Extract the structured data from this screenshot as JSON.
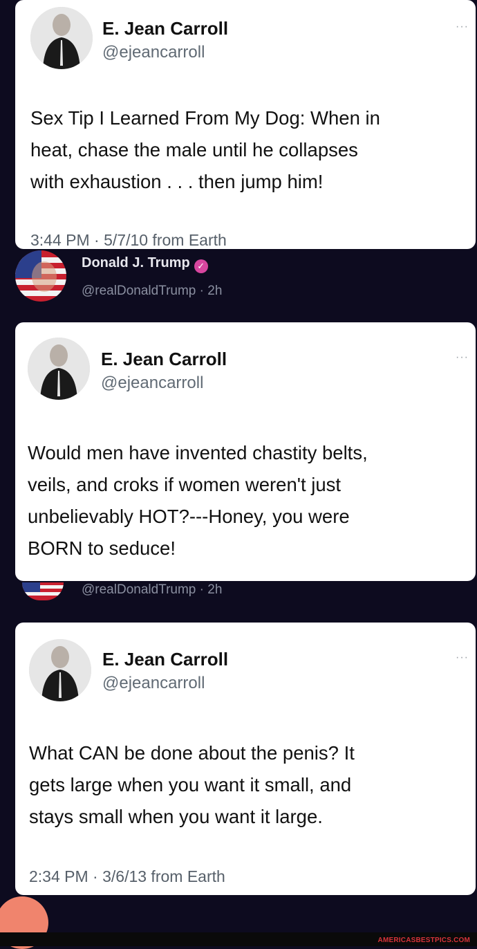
{
  "tweets": [
    {
      "name": "E. Jean Carroll",
      "handle": "@ejeancarroll",
      "more": "···",
      "text_lines": [
        "Sex Tip I Learned From My Dog:  When in",
        "heat, chase the male until he collapses",
        "with exhaustion  . . . then jump him!"
      ],
      "meta": "3:44 PM · 5/7/10 from Earth"
    },
    {
      "name": "E. Jean Carroll",
      "handle": "@ejeancarroll",
      "more": "···",
      "text_lines": [
        "Would men have invented chastity belts,",
        "veils, and croks if women weren't just",
        "unbelievably HOT?---Honey, you were",
        "BORN to seduce!"
      ]
    },
    {
      "name": "E. Jean Carroll",
      "handle": "@ejeancarroll",
      "more": "···",
      "text_lines": [
        "What CAN be done about the penis? It",
        "gets large when you want it small, and",
        "stays small when you want it large."
      ],
      "meta": "2:34 PM · 3/6/13 from Earth"
    }
  ],
  "trump": {
    "name": "Donald J. Trump",
    "handle_time": "@realDonaldTrump · 2h",
    "handle_time_2": "@realDonaldTrump · 2h",
    "verified_icon": "verified-badge-icon"
  },
  "watermark": "AMERICASBESTPICS.COM",
  "colors": {
    "background": "#0d0b1f",
    "card": "#ffffff",
    "verified": "#d7469f",
    "watermark": "#d8343a"
  }
}
